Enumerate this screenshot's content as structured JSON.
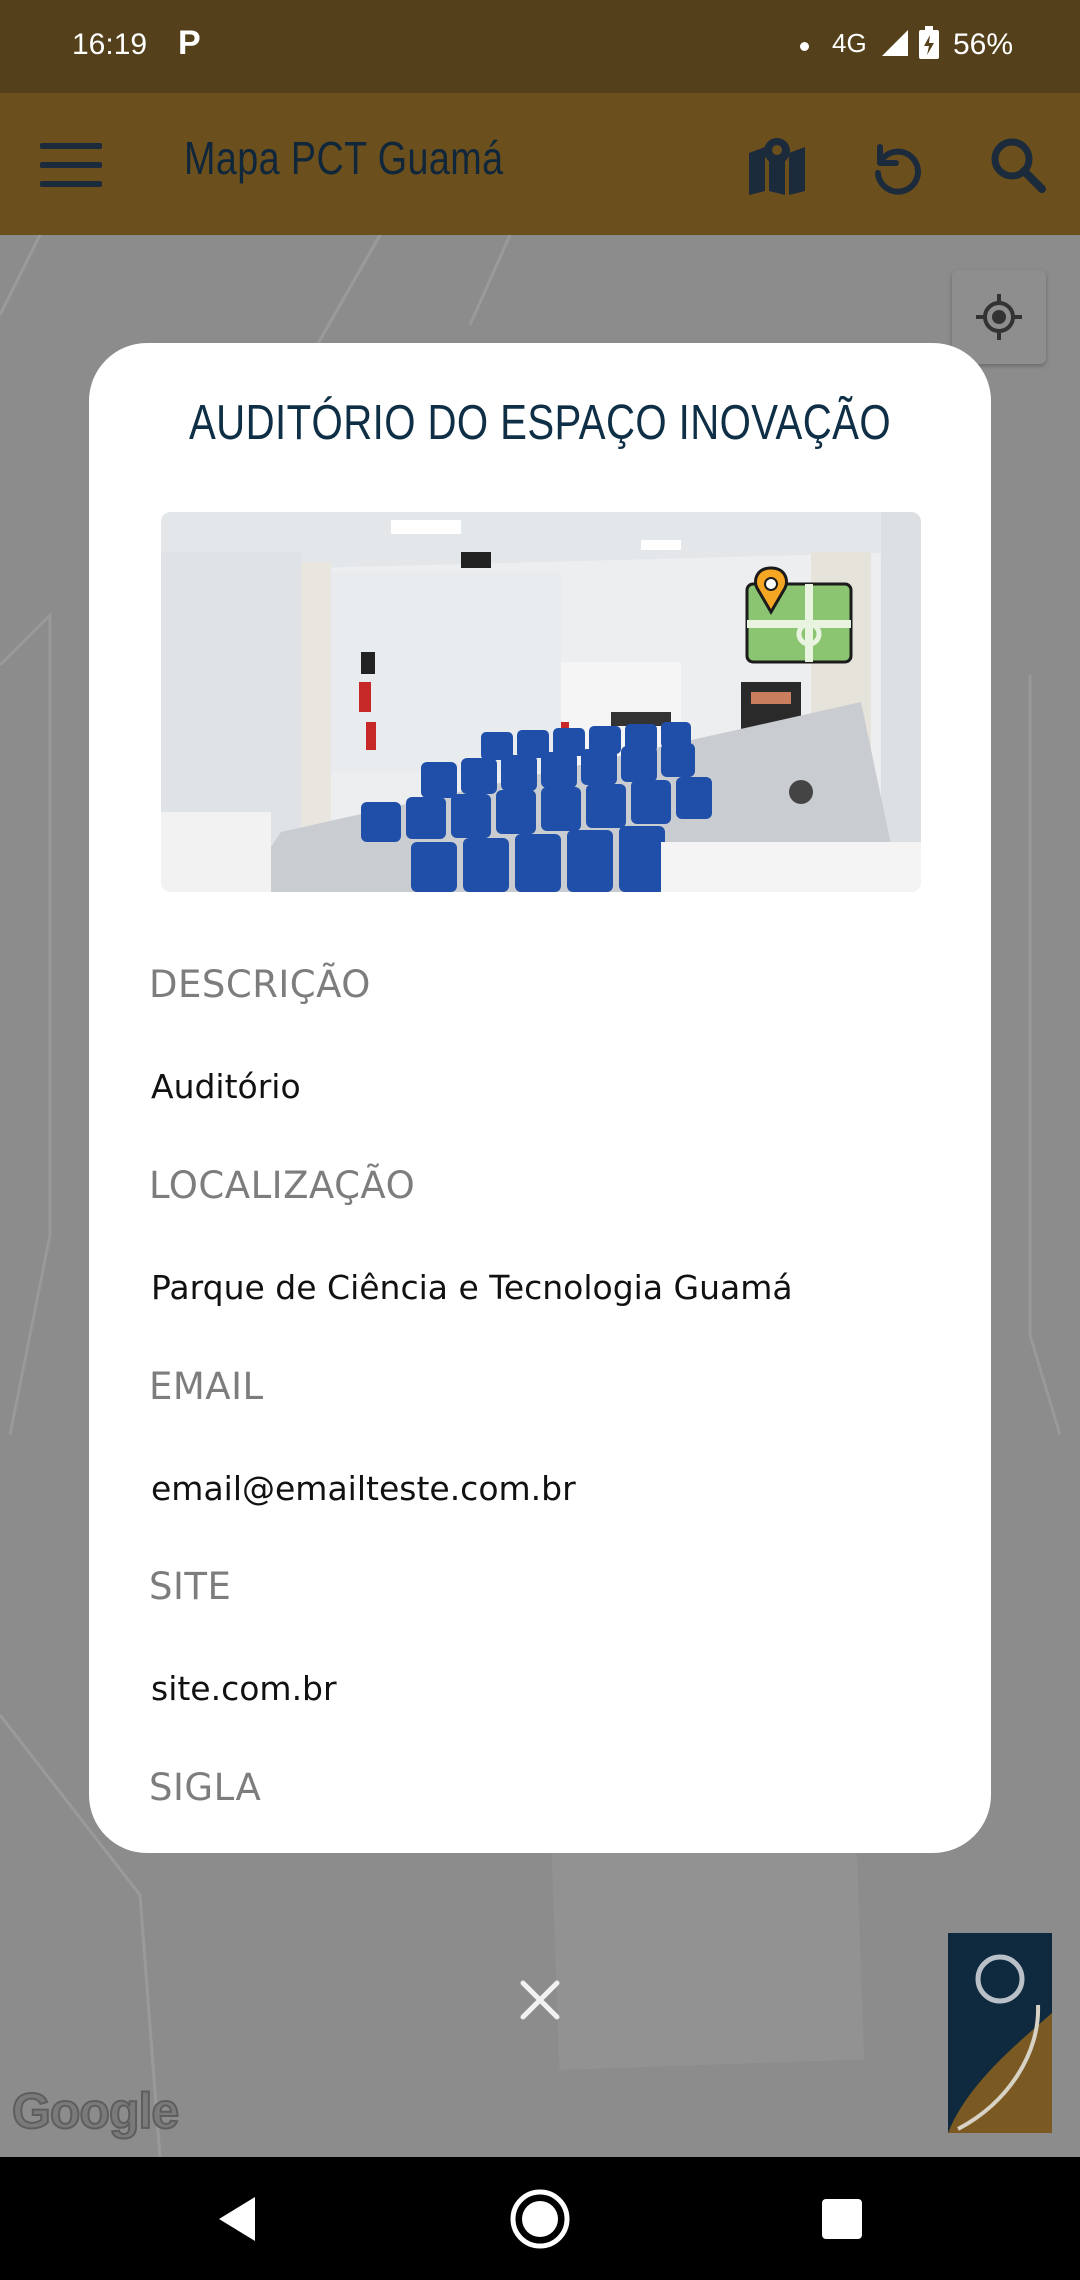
{
  "status_bar": {
    "time": "16:19",
    "notification": "P",
    "network": "4G",
    "battery": "56%"
  },
  "app_bar": {
    "title": "Mapa PCT Guamá",
    "icons": [
      "menu-icon",
      "map-icon",
      "refresh-icon",
      "search-icon"
    ]
  },
  "map": {
    "attribution": "Google",
    "icons": [
      "my-location-icon",
      "pct-logo"
    ]
  },
  "modal": {
    "title": "AUDITÓRIO DO ESPAÇO INOVAÇÃO",
    "fields": [
      {
        "label": "DESCRIÇÃO",
        "value": "Auditório"
      },
      {
        "label": "LOCALIZAÇÃO",
        "value": "Parque de Ciência e Tecnologia Guamá"
      },
      {
        "label": "EMAIL",
        "value": "email@emailteste.com.br"
      },
      {
        "label": "SITE",
        "value": "site.com.br"
      },
      {
        "label": "SIGLA",
        "value": ""
      }
    ]
  },
  "colors": {
    "status_bar": "#54401a",
    "app_bar": "#6b4f1d",
    "title_text": "#10263a",
    "modal_title": "#0e2f45",
    "label_text": "#7d7d7d"
  },
  "nav_bar": {
    "icons": [
      "back-icon",
      "home-icon",
      "recents-icon"
    ]
  }
}
